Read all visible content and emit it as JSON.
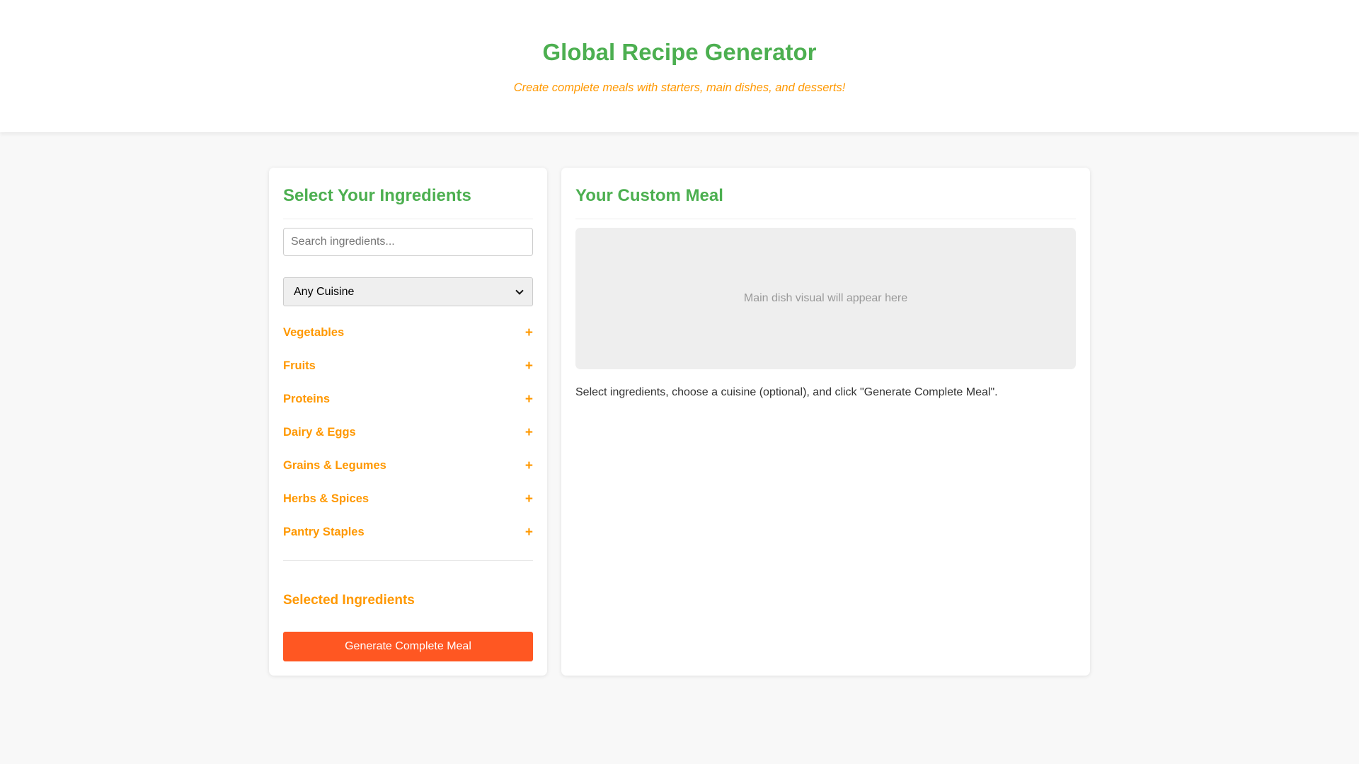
{
  "header": {
    "title": "Global Recipe Generator",
    "subtitle": "Create complete meals with starters, main dishes, and desserts!"
  },
  "ingredients_panel": {
    "title": "Select Your Ingredients",
    "search": {
      "placeholder": "Search ingredients...",
      "value": ""
    },
    "cuisine_select": {
      "selected": "Any Cuisine"
    },
    "categories": [
      {
        "label": "Vegetables",
        "toggle": "+"
      },
      {
        "label": "Fruits",
        "toggle": "+"
      },
      {
        "label": "Proteins",
        "toggle": "+"
      },
      {
        "label": "Dairy & Eggs",
        "toggle": "+"
      },
      {
        "label": "Grains & Legumes",
        "toggle": "+"
      },
      {
        "label": "Herbs & Spices",
        "toggle": "+"
      },
      {
        "label": "Pantry Staples",
        "toggle": "+"
      }
    ],
    "selected_title": "Selected Ingredients",
    "generate_button": "Generate Complete Meal"
  },
  "meal_panel": {
    "title": "Your Custom Meal",
    "visual_placeholder": "Main dish visual will appear here",
    "instructions": "Select ingredients, choose a cuisine (optional), and click \"Generate Complete Meal\"."
  },
  "colors": {
    "title_green": "#4caf50",
    "accent_orange": "#ff9800",
    "button_orange": "#ff5722",
    "background": "#f8f8f8"
  }
}
